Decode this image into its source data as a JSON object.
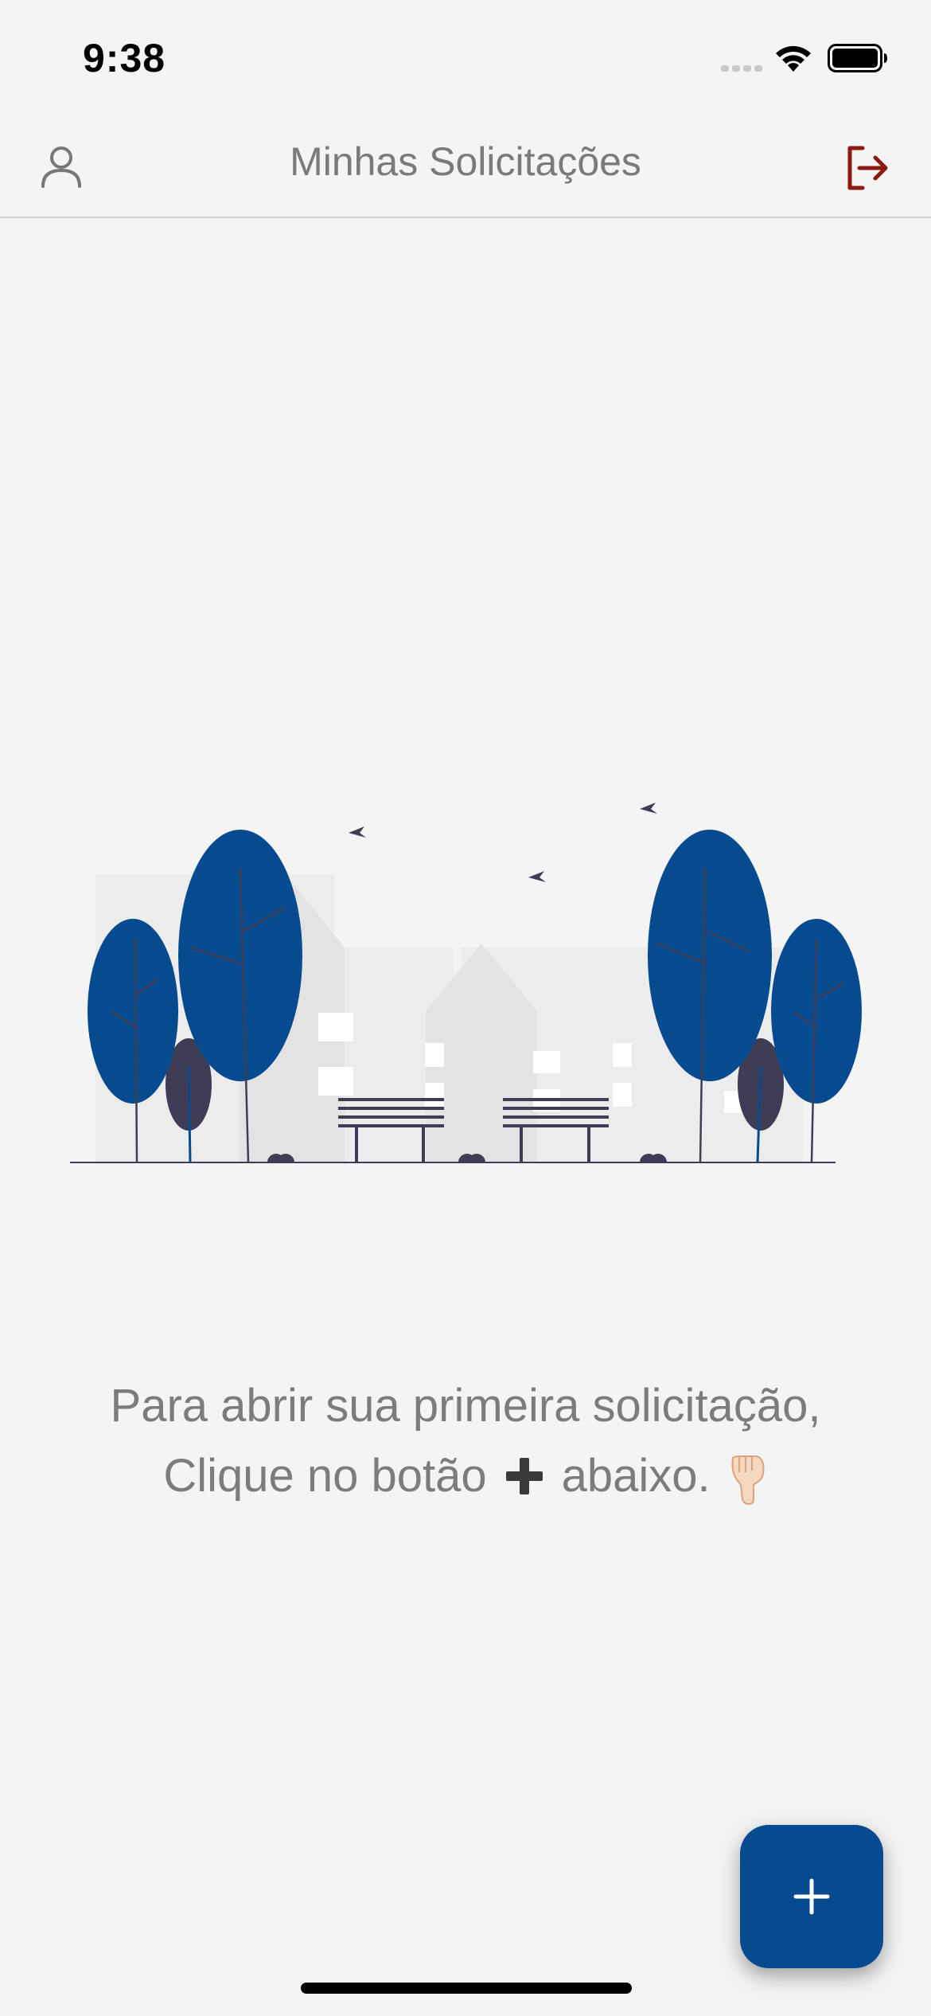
{
  "status_bar": {
    "time": "9:38",
    "icons": [
      "cellular-signal-icon",
      "wifi-icon",
      "battery-icon"
    ]
  },
  "nav_bar": {
    "title": "Minhas Solicitações",
    "left_icon": "user-icon",
    "right_icon": "logout-icon"
  },
  "empty_state": {
    "illustration": "park-city-illustration",
    "line1": "Para abrir sua primeira solicitação,",
    "line2_before": "Clique no botão",
    "line2_icon": "plus-icon",
    "line2_after": "abaixo.",
    "line2_emoji": "pointing-down-hand-icon"
  },
  "fab": {
    "icon": "plus-icon"
  },
  "colors": {
    "background": "#f4f4f4",
    "primary": "#064a8f",
    "logout": "#8b1a10",
    "text_muted": "#7c7c7c"
  }
}
